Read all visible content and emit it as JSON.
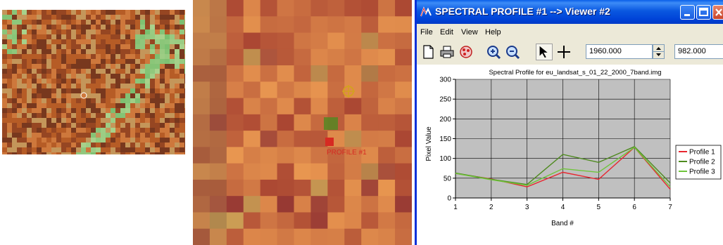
{
  "window": {
    "title": "SPECTRAL PROFILE #1 --> Viewer #2"
  },
  "menu": [
    "File",
    "Edit",
    "View",
    "Help"
  ],
  "toolbar": {
    "icons": [
      "new-document-icon",
      "print-icon",
      "palette-icon",
      "zoom-in-icon",
      "zoom-out-icon",
      "select-arrow-icon",
      "crosshair-icon"
    ],
    "x_coordinate": "1960.000",
    "y_coordinate": "982.000"
  },
  "viewer": {
    "profile_label": "PROFILE #1"
  },
  "colors": {
    "profile_1": "#e8262f",
    "profile_2": "#4e8a1e",
    "profile_3": "#6fc43a",
    "plot_background": "#c0c0c0",
    "title_bar": "#0a5fe8"
  },
  "chart_data": {
    "type": "line",
    "title": "Spectral Profile for eu_landsat_s_01_22_2000_7band.img",
    "xlabel": "Band #",
    "ylabel": "Pixel Value",
    "x": [
      1,
      2,
      3,
      4,
      5,
      6,
      7
    ],
    "xlim": [
      1,
      7
    ],
    "ylim": [
      0,
      300
    ],
    "yticks": [
      0,
      50,
      100,
      150,
      200,
      250,
      300
    ],
    "grid": true,
    "legend_position": "right",
    "series": [
      {
        "name": "Profile 1",
        "color": "#e8262f",
        "values": [
          62,
          48,
          28,
          65,
          47,
          128,
          22
        ]
      },
      {
        "name": "Profile 2",
        "color": "#4e8a1e",
        "values": [
          63,
          47,
          34,
          110,
          90,
          130,
          38
        ]
      },
      {
        "name": "Profile 3",
        "color": "#6fc43a",
        "values": [
          62,
          46,
          32,
          74,
          65,
          128,
          28
        ]
      }
    ]
  }
}
